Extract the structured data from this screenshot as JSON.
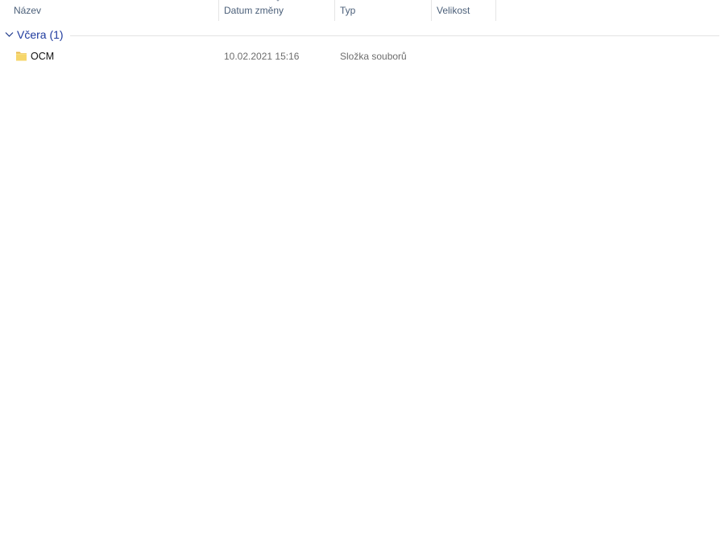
{
  "columns": {
    "name": "Název",
    "date": "Datum změny",
    "type": "Typ",
    "size": "Velikost"
  },
  "sort": {
    "column": "date",
    "icon": "chevron-down-icon"
  },
  "group": {
    "title": "Včera (1)",
    "icon": "chevron-down-icon",
    "accent": "#1e3a9e"
  },
  "rows": [
    {
      "name": "OCM",
      "date": "10.02.2021 15:16",
      "type": "Složka souborů",
      "size": "",
      "icon": "folder-icon"
    }
  ],
  "colors": {
    "folder": "#f6d66b",
    "header_text": "#4c607a"
  }
}
